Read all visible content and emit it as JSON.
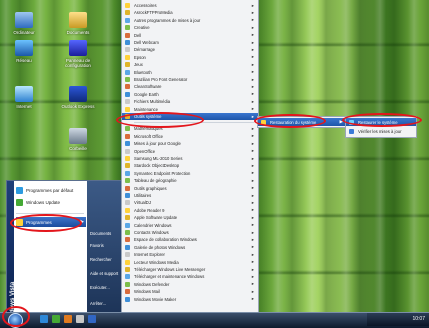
{
  "desktop_icons": [
    {
      "label": "Ordinateur"
    },
    {
      "label": "Documents"
    },
    {
      "label": "Réseau"
    },
    {
      "label": "Panneau de configuration"
    },
    {
      "label": "Internet"
    },
    {
      "label": "Outlook Express"
    },
    {
      "label": "Corbeille"
    }
  ],
  "start_menu": {
    "brand": "Windows Vista",
    "items": [
      {
        "label": "Programmes par défaut"
      },
      {
        "label": "Windows Update"
      },
      {
        "label": "Programmes",
        "selected": true
      }
    ],
    "right_items": [
      {
        "label": "Documents"
      },
      {
        "label": "Favoris"
      },
      {
        "label": "Rechercher"
      },
      {
        "label": "Aide et support"
      },
      {
        "label": "Exécuter..."
      },
      {
        "label": "Arrêter..."
      }
    ]
  },
  "programs_menu": {
    "items_top": [
      {
        "label": "Accessoires"
      },
      {
        "label": "AsrockFTPProMedia"
      },
      {
        "label": "Autres programmes de mises à jour"
      },
      {
        "label": "Creative"
      },
      {
        "label": "Dell"
      },
      {
        "label": "Dell Webcam"
      },
      {
        "label": "Démarrage"
      },
      {
        "label": "Epson"
      },
      {
        "label": "Jeux"
      },
      {
        "label": "Bluetooth"
      },
      {
        "label": "Brazilian Pro Font Generator"
      },
      {
        "label": "CleanSoftware"
      },
      {
        "label": "Google Earth"
      },
      {
        "label": "Fichiers Multimédia"
      },
      {
        "label": "Maintenance"
      },
      {
        "label": "Outils système",
        "selected": true
      }
    ],
    "items_mid": [
      {
        "label": "Mathématiques"
      },
      {
        "label": "Microsoft Office"
      },
      {
        "label": "Mises à jour pour Google"
      },
      {
        "label": "OpenOffice"
      },
      {
        "label": "Samsung ML-2010 Series"
      },
      {
        "label": "Stardock ObjectDesktop"
      },
      {
        "label": "Symantec Endpoint Protection"
      },
      {
        "label": "Tableau de géographie"
      },
      {
        "label": "Outils graphiques"
      },
      {
        "label": "Utilitaires"
      },
      {
        "label": "VirtualDJ"
      },
      {
        "label": "Adobe Reader 9"
      },
      {
        "label": "Apple Software Update"
      },
      {
        "label": "Calendrier Windows"
      },
      {
        "label": "Contacts Windows"
      },
      {
        "label": "Espace de collaboration Windows"
      },
      {
        "label": "Galerie de photos Windows"
      },
      {
        "label": "Internet Explorer"
      },
      {
        "label": "Lecteur Windows Media"
      },
      {
        "label": "Télécharger Windows Live Messenger"
      },
      {
        "label": "Télécharger et maintenance Windows"
      },
      {
        "label": "Windows Defender"
      },
      {
        "label": "Windows Mail"
      },
      {
        "label": "Windows Movie Maker"
      }
    ]
  },
  "submenu1": {
    "items": [
      {
        "label": "Restauration du système",
        "selected": true
      }
    ]
  },
  "submenu2": {
    "items": [
      {
        "label": "Restaurer le système",
        "selected": true
      },
      {
        "label": "Vérifier les mises à jour"
      }
    ]
  },
  "taskbar": {
    "clock": "10:07"
  }
}
